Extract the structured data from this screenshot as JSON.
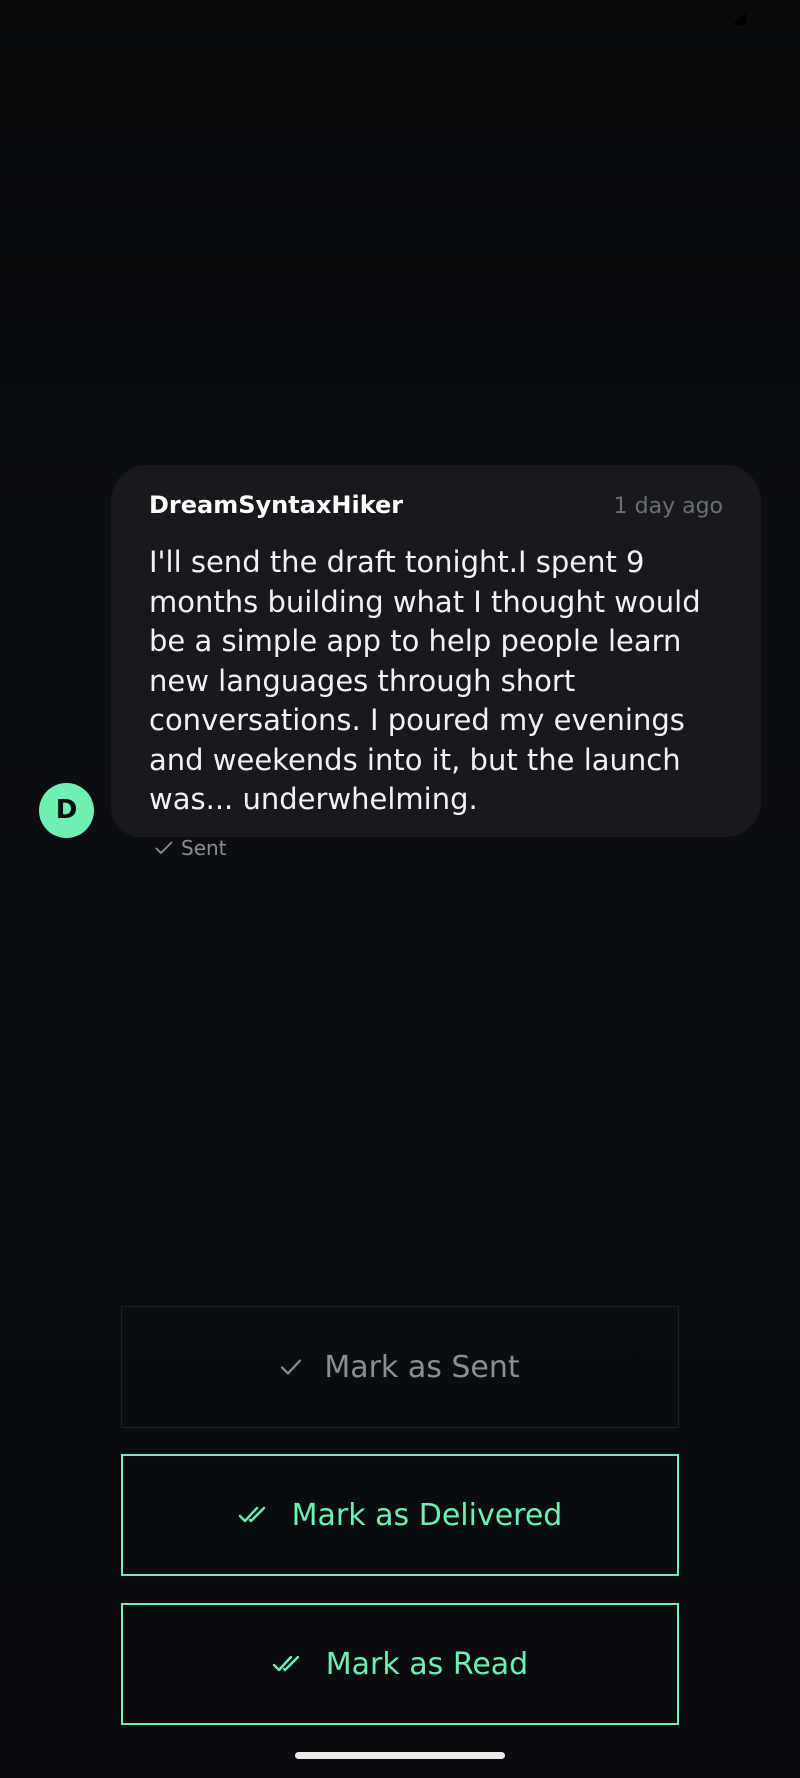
{
  "colors": {
    "accent": "#6ff0b3",
    "background": "#0a0d10",
    "bubble": "#17191d"
  },
  "message": {
    "avatar_letter": "D",
    "sender": "DreamSyntaxHiker",
    "timestamp": "1 day ago",
    "text": "I'll send the draft tonight.I spent 9 months building what I thought would be a simple app to help people learn new languages through short conversations. I poured my evenings and weekends into it, but the launch was... underwhelming.",
    "status": "Sent",
    "status_icon": "check-icon"
  },
  "actions": {
    "sent_label": "Mark as Sent",
    "sent_icon": "check-icon",
    "delivered_label": "Mark as Delivered",
    "delivered_icon": "double-check-icon",
    "read_label": "Mark as Read",
    "read_icon": "double-check-icon"
  }
}
